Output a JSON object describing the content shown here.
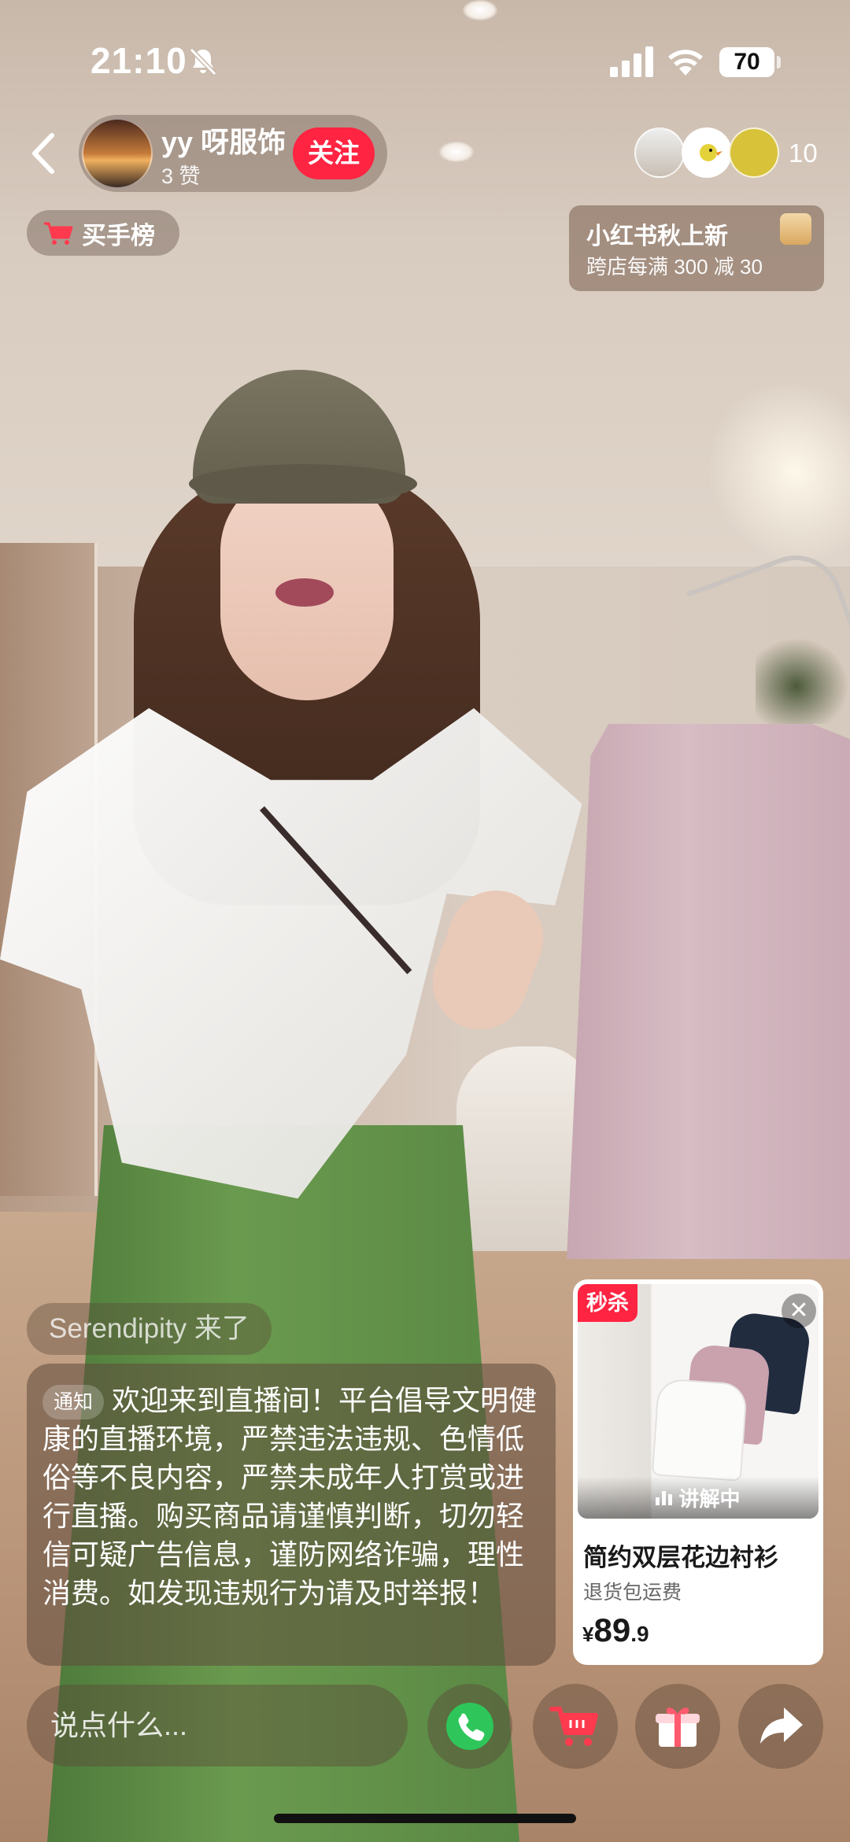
{
  "status_bar": {
    "time": "21:10",
    "battery": "70"
  },
  "host": {
    "name": "yy 呀服饰",
    "likes": "3 赞",
    "follow_label": "关注"
  },
  "viewers": {
    "count": "10"
  },
  "rank_badge": {
    "label": "买手榜"
  },
  "promo": {
    "title": "小红书秋上新",
    "subtitle": "跨店每满 300 减 30"
  },
  "chat": {
    "join_message": "Serendipity 来了",
    "notice_tag": "通知",
    "notice_text": "欢迎来到直播间！平台倡导文明健康的直播环境，严禁违法违规、色情低俗等不良内容，严禁未成年人打赏或进行直播。购买商品请谨慎判断，切勿轻信可疑广告信息，谨防网络诈骗，理性消费。如发现违规行为请及时举报！"
  },
  "product": {
    "flash_tag": "秒杀",
    "explaining_label": "讲解中",
    "name": "简约双层花边衬衫",
    "subtitle": "退货包运费",
    "price_symbol": "¥",
    "price_int": "89",
    "price_dec": ".9"
  },
  "bottom_bar": {
    "comment_placeholder": "说点什么..."
  },
  "colors": {
    "accent": "#ff2442",
    "overlay": "rgba(90,70,55,0.42)",
    "phone_green": "#2ec65a"
  },
  "icons": [
    "back-icon",
    "bell-off-icon",
    "signal-icon",
    "wifi-icon",
    "cart-icon",
    "close-icon",
    "phone-icon",
    "shopping-cart-icon",
    "gift-icon",
    "share-icon"
  ]
}
